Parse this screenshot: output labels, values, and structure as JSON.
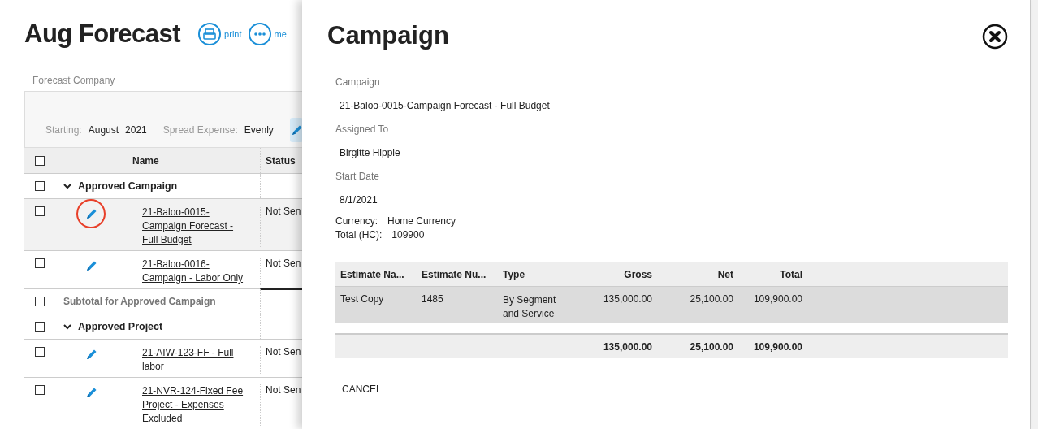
{
  "page": {
    "title": "Aug Forecast",
    "actions": [
      {
        "kind": "print",
        "label": "print"
      },
      {
        "kind": "more",
        "label": "me"
      }
    ],
    "company": "Forecast Company",
    "filters": [
      {
        "label": "Starting:",
        "values": [
          "August",
          "2021"
        ]
      },
      {
        "label": "Spread Expense:",
        "values": [
          "Evenly"
        ]
      }
    ],
    "table": {
      "all_checked": false,
      "columns": [
        "Name",
        "Status"
      ],
      "rows": [
        {
          "kind": "group",
          "name": "Approved Campaign",
          "expanded": true,
          "checked": false
        },
        {
          "kind": "item",
          "name": "21-Baloo-0015-Campaign Forecast - Full Budget",
          "status": "Not Sen",
          "checked": false,
          "selected": true,
          "circled": true
        },
        {
          "kind": "item",
          "name": "21-Baloo-0016-Campaign - Labor Only",
          "status": "Not Sen",
          "checked": false,
          "selected": false,
          "circled": false
        },
        {
          "kind": "subtotal",
          "name": "Subtotal for Approved Campaign",
          "checked": false
        },
        {
          "kind": "group",
          "name": "Approved Project",
          "expanded": true,
          "checked": false
        },
        {
          "kind": "item",
          "name": "21-AIW-123-FF - Full labor",
          "status": "Not Sen",
          "checked": false,
          "selected": false,
          "circled": false
        },
        {
          "kind": "item",
          "name": "21-NVR-124-Fixed Fee Project - Expenses Excluded",
          "status": "Not Sen",
          "checked": false,
          "selected": false,
          "circled": false
        }
      ]
    }
  },
  "panel": {
    "title": "Campaign",
    "fields": [
      {
        "label": "Campaign",
        "value": "21-Baloo-0015-Campaign Forecast - Full Budget"
      },
      {
        "label": "Assigned To",
        "value": "Birgitte Hipple"
      },
      {
        "label": "Start Date",
        "value": "8/1/2021"
      }
    ],
    "summary": [
      {
        "label": "Currency:",
        "value": "Home Currency"
      },
      {
        "label": "Total (HC):",
        "value": "109900"
      }
    ],
    "estimates": {
      "columns": [
        "Estimate Na...",
        "Estimate Nu...",
        "Type",
        "Gross",
        "Net",
        "Total"
      ],
      "rows": [
        [
          "Test Copy",
          "1485",
          "By Segment and Service",
          "135,000.00",
          "25,100.00",
          "109,900.00"
        ]
      ],
      "totals": [
        "135,000.00",
        "25,100.00",
        "109,900.00"
      ]
    },
    "cancel": "CANCEL"
  }
}
